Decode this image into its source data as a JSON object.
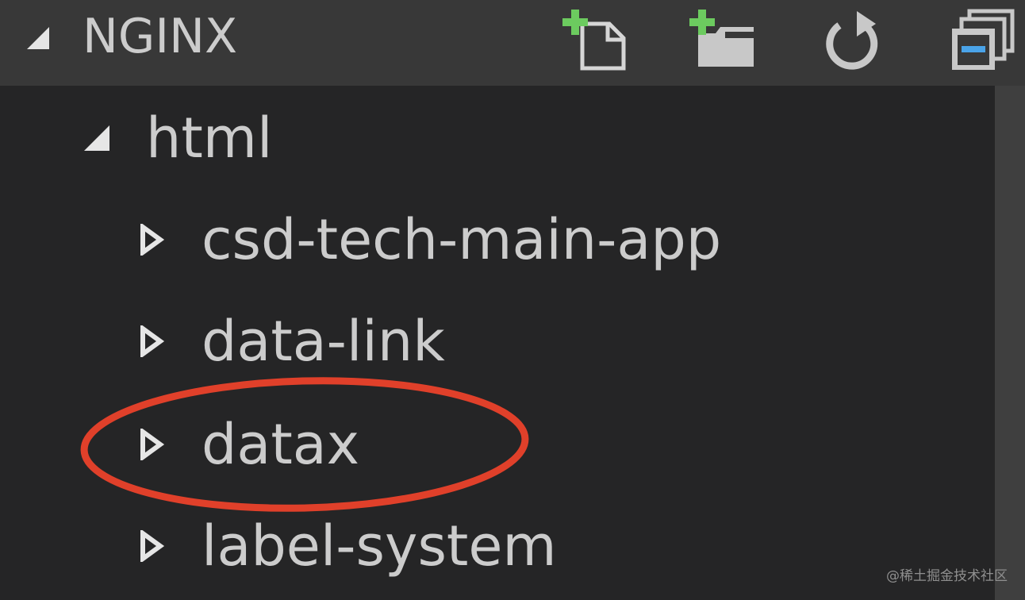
{
  "header": {
    "title": "NGINX",
    "twisty_icon": "triangle-expanded-icon",
    "actions": [
      {
        "name": "new-file",
        "icon": "new-file-icon"
      },
      {
        "name": "new-folder",
        "icon": "new-folder-icon"
      },
      {
        "name": "refresh",
        "icon": "refresh-icon"
      },
      {
        "name": "collapse-all",
        "icon": "collapse-all-icon"
      }
    ]
  },
  "tree": {
    "root_folder": {
      "label": "html",
      "expanded": true
    },
    "children": [
      {
        "label": "csd-tech-main-app",
        "expanded": false
      },
      {
        "label": "data-link",
        "expanded": false
      },
      {
        "label": "datax",
        "expanded": false,
        "highlighted": true
      },
      {
        "label": "label-system",
        "expanded": false
      }
    ]
  },
  "colors": {
    "header_bg": "#383838",
    "panel_bg": "#252526",
    "text": "#cccccc",
    "plus_green": "#6ccb5f",
    "annotation_red": "#e0402a",
    "scrollbar": "#3f3f3f"
  },
  "watermark": "@稀土掘金技术社区"
}
